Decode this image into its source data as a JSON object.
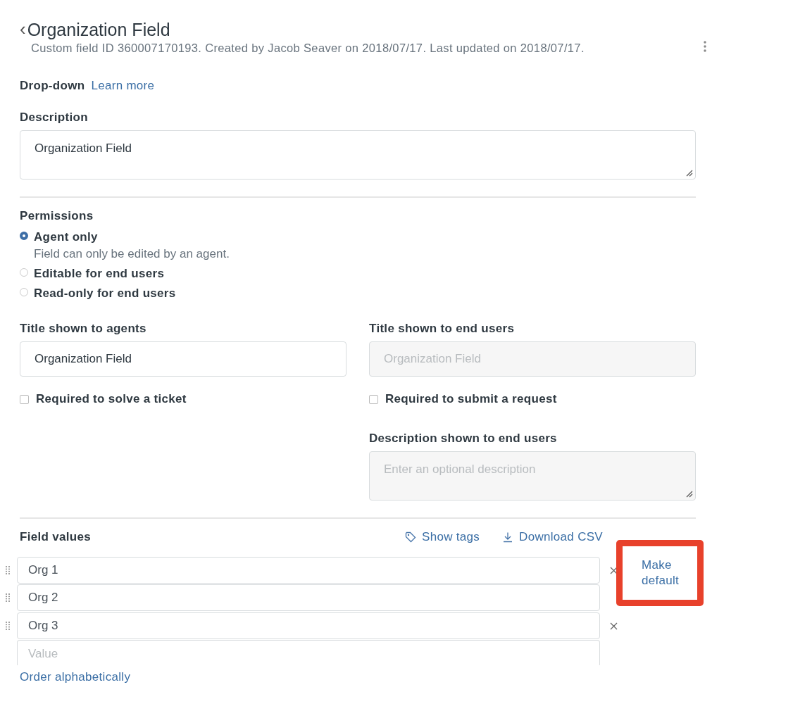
{
  "header": {
    "back_icon": "‹",
    "title": "Organization Field",
    "subtitle": "Custom field ID 360007170193. Created by Jacob Seaver on 2018/07/17. Last updated on 2018/07/17."
  },
  "field_type": {
    "label": "Drop-down",
    "link": "Learn more"
  },
  "description": {
    "label": "Description",
    "value": "Organization Field"
  },
  "permissions": {
    "label": "Permissions",
    "options": [
      {
        "label": "Agent only",
        "hint": "Field can only be edited by an agent.",
        "selected": true
      },
      {
        "label": "Editable for end users",
        "selected": false
      },
      {
        "label": "Read-only for end users",
        "selected": false
      }
    ]
  },
  "agent_title": {
    "label": "Title shown to agents",
    "value": "Organization Field",
    "required_label": "Required to solve a ticket",
    "required_checked": false
  },
  "end_user_title": {
    "label": "Title shown to end users",
    "placeholder": "Organization Field",
    "required_label": "Required to submit a request",
    "required_checked": false,
    "description_label": "Description shown to end users",
    "description_placeholder": "Enter an optional description"
  },
  "field_values": {
    "label": "Field values",
    "show_tags": "Show tags",
    "download_csv": "Download CSV",
    "rows": [
      {
        "value": "Org 1",
        "make_default": "Make default",
        "highlighted": true
      },
      {
        "value": "Org 2",
        "highlighted": false
      },
      {
        "value": "Org 3",
        "highlighted": false
      }
    ],
    "new_placeholder": "Value",
    "order_link": "Order alphabetically"
  }
}
